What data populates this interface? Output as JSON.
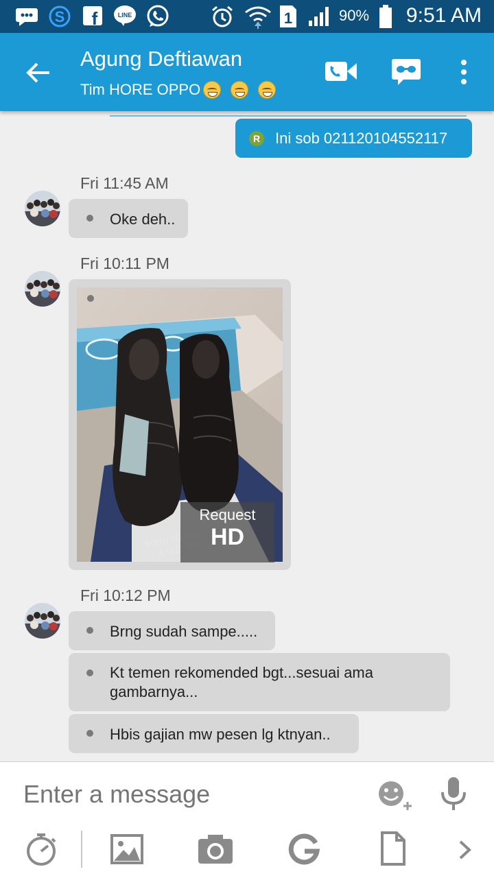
{
  "status_bar": {
    "battery_percent": "90%",
    "time": "9:51 AM",
    "sim_slot": "1",
    "icons": [
      "bbm-icon",
      "s-app-icon",
      "facebook-icon",
      "line-icon",
      "whatsapp-icon",
      "alarm-icon",
      "wifi-icon",
      "sim-icon",
      "signal-icon",
      "battery-icon"
    ]
  },
  "header": {
    "back_icon": "arrow-left-icon",
    "contact_name": "Agung Deftiawan",
    "status_text": "Tim HORE OPPO",
    "actions": [
      "video-call-icon",
      "glasses-icon",
      "more-vert-icon"
    ]
  },
  "messages": {
    "outgoing": {
      "badge": "R",
      "text": "Ini sob 021120104552117"
    },
    "group1": {
      "timestamp": "Fri 11:45 AM",
      "items": [
        {
          "text": "Oke deh.."
        }
      ]
    },
    "group2": {
      "timestamp": "Fri 10:11 PM",
      "image": {
        "description_hidden": true,
        "box_label": "BORN TO MAKE A HISTORY",
        "request_hd_line1": "Request",
        "request_hd_line2": "HD"
      }
    },
    "group3": {
      "timestamp": "Fri 10:12 PM",
      "items": [
        {
          "text": "Brng sudah sampe....."
        },
        {
          "text": "Kt temen rekomended bgt...sesuai ama gambarnya..."
        },
        {
          "text": "Hbis gajian mw pesen lg ktnyan.."
        }
      ]
    }
  },
  "composer": {
    "placeholder": "Enter a message",
    "tools": [
      "timer-icon",
      "image-icon",
      "camera-icon",
      "google-icon",
      "file-icon",
      "chevron-right-icon"
    ],
    "right_icons": [
      "emoji-add-icon",
      "microphone-icon"
    ]
  },
  "colors": {
    "status_bar": "#0d4f7a",
    "app_bar": "#1b9ad6",
    "outgoing_bubble": "#1b9ad6",
    "incoming_bubble": "#d7d7d7",
    "background": "#efefef"
  }
}
